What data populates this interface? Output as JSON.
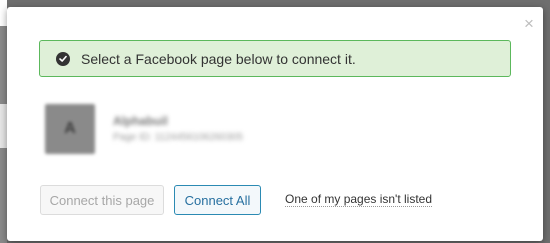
{
  "modal": {
    "close_glyph": "×",
    "notice": {
      "icon": "check-circle-icon",
      "text": "Select a Facebook page below to connect it."
    },
    "page": {
      "avatar_letter": "A",
      "name": "Alphabuil",
      "id_text": "Page ID: 1124456106260305"
    },
    "buttons": {
      "connect_page": "Connect this page",
      "connect_all": "Connect All"
    },
    "link": "One of my pages isn't listed"
  },
  "colors": {
    "notice_bg": "#dff0d8",
    "notice_border": "#5cb85c",
    "primary_btn_border": "#2b8ab3",
    "primary_btn_text": "#2770a0"
  }
}
